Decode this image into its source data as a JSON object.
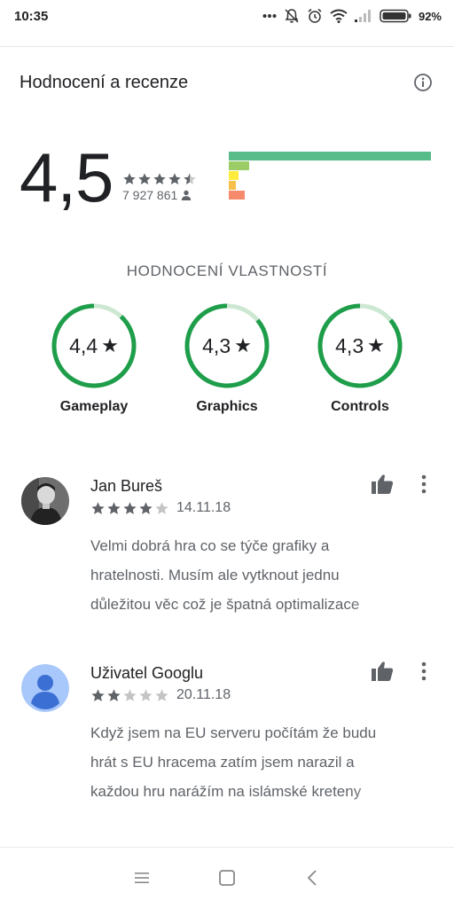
{
  "status_bar": {
    "time": "10:35",
    "battery": "92%",
    "icons": [
      "more-dots-icon",
      "bell-muted-icon",
      "alarm-icon",
      "wifi-icon",
      "signal-icon",
      "battery-icon"
    ]
  },
  "header": {
    "title": "Hodnocení a recenze",
    "info_icon": "info-icon"
  },
  "summary": {
    "rating": "4,5",
    "stars": 4.5,
    "count": "7 927 861",
    "count_icon": "person-icon",
    "distribution": [
      {
        "stars": 5,
        "fraction": 1.0,
        "color": "#57bb8a"
      },
      {
        "stars": 4,
        "fraction": 0.1,
        "color": "#9ccc65"
      },
      {
        "stars": 3,
        "fraction": 0.05,
        "color": "#ffeb3b"
      },
      {
        "stars": 2,
        "fraction": 0.02,
        "color": "#f7c04a"
      },
      {
        "stars": 1,
        "fraction": 0.08,
        "color": "#f58a6d"
      }
    ]
  },
  "features": {
    "heading": "HODNOCENÍ VLASTNOSTÍ",
    "items": [
      {
        "value": "4,4",
        "score": 4.4,
        "label": "Gameplay"
      },
      {
        "value": "4,3",
        "score": 4.3,
        "label": "Graphics"
      },
      {
        "value": "4,3",
        "score": 4.3,
        "label": "Controls"
      }
    ],
    "ring_color": "#1e9e4a",
    "ring_track": "#cde8d2"
  },
  "reviews": [
    {
      "name": "Jan Bureš",
      "stars": 4,
      "date": "14.11.18",
      "lines": [
        "Velmi dobrá hra co se týče grafiky a",
        "hratelnosti. Musím ale vytknout jednu",
        "důležitou věc což je špatná optimalizace"
      ]
    },
    {
      "name": "Uživatel Googlu",
      "stars": 2,
      "date": "20.11.18",
      "lines": [
        "Když jsem na EU serveru počítám že budu",
        "hrát s EU hracema zatím jsem narazil a",
        "každou hru narážím na islámské kreteny"
      ]
    }
  ],
  "nav": {
    "icons": [
      "menu-icon",
      "home-icon",
      "back-icon"
    ]
  }
}
